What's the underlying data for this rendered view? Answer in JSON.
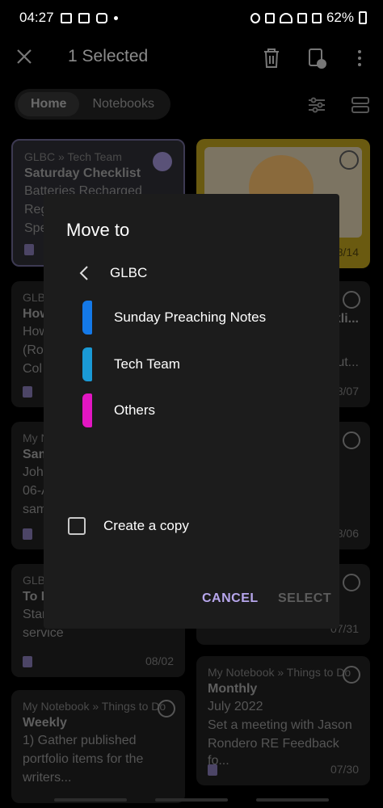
{
  "status_bar": {
    "time": "04:27",
    "battery": "62%"
  },
  "app_bar": {
    "title": "1 Selected"
  },
  "tabs": [
    {
      "label": "Home",
      "active": true
    },
    {
      "label": "Notebooks",
      "active": false
    }
  ],
  "background_cards": [
    {
      "path": "GLBC » Tech Team",
      "title": "Saturday Checklist",
      "body": [
        "Batteries Recharged",
        "Reg",
        "Spe"
      ],
      "date": "",
      "selected": true
    },
    {
      "path": "GLB",
      "title": "How",
      "body": [
        "How",
        "(Roc",
        "Col"
      ],
      "date": ""
    },
    {
      "path": "My N",
      "title": "Sam",
      "body": [
        "John",
        "06-A",
        "sam"
      ],
      "date": ""
    },
    {
      "path": "GLB",
      "title": "To D",
      "body": [
        "Star",
        "service"
      ],
      "date": "08/02"
    },
    {
      "path": "My Notebook » Things to Do",
      "title": "Weekly",
      "body": [
        "1) Gather published",
        "portfolio items for the",
        "writers..."
      ],
      "date": ""
    },
    {
      "path": "",
      "title": "",
      "body": [
        ""
      ],
      "date": "08/14"
    },
    {
      "path": "",
      "title": "kli...",
      "body": [
        "",
        "ut..."
      ],
      "date": "08/07"
    },
    {
      "path": "",
      "title": "",
      "body": [
        ""
      ],
      "date": "08/06"
    },
    {
      "path": "",
      "title": "",
      "body": [
        ""
      ],
      "date": "07/31"
    },
    {
      "path": "My Notebook » Things to Do",
      "title": "Monthly",
      "body": [
        "July 2022",
        "Set a meeting with Jason",
        "Rondero RE Feedback fo..."
      ],
      "date": "07/30"
    }
  ],
  "dialog": {
    "title": "Move to",
    "breadcrumb": "GLBC",
    "folders": [
      {
        "label": "Sunday Preaching Notes",
        "color": "#1479e8"
      },
      {
        "label": "Tech Team",
        "color": "#1a9ad6"
      },
      {
        "label": "Others",
        "color": "#e216c2"
      }
    ],
    "copy_label": "Create a copy",
    "copy_checked": false,
    "cancel_label": "CANCEL",
    "select_label": "SELECT"
  }
}
